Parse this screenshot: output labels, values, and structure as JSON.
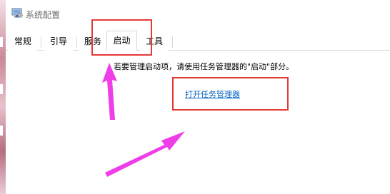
{
  "window": {
    "title": "系统配置",
    "icon": "settings-window-icon"
  },
  "tabs": [
    {
      "label": "常规"
    },
    {
      "label": "引导"
    },
    {
      "label": "服务"
    },
    {
      "label": "启动"
    },
    {
      "label": "工具"
    }
  ],
  "active_tab": "启动",
  "startup": {
    "info_text": "若要管理启动项，请使用任务管理器的\"启动\"部分。",
    "link_text": "打开任务管理器"
  },
  "annotations": {
    "highlight_color": "#e53935",
    "arrow_color": "#ee3ee8"
  }
}
